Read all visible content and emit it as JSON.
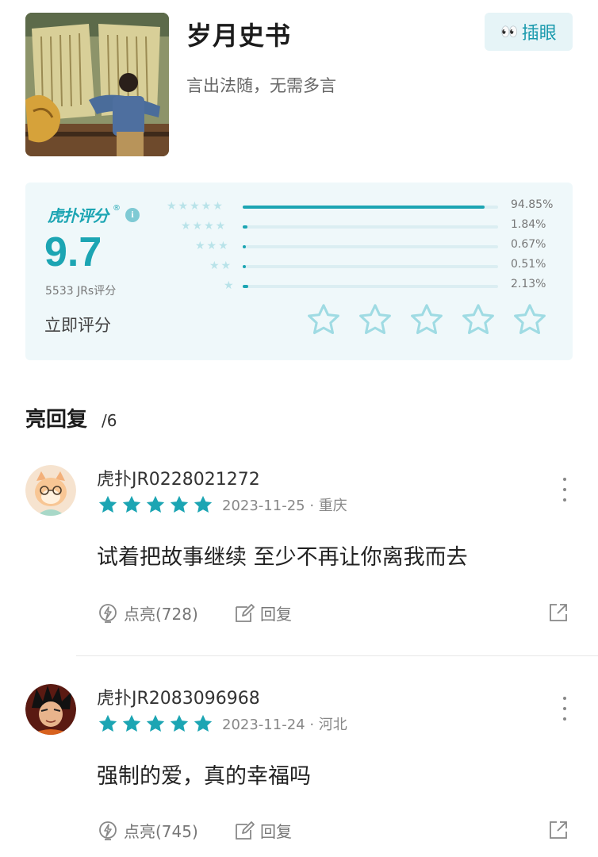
{
  "header": {
    "title": "岁月史书",
    "subtitle": "言出法随，无需多言",
    "tag_label": "插眼",
    "tag_icon": "eyes-icon"
  },
  "rating": {
    "brand": "虎扑评分",
    "score": "9.7",
    "count_text": "5533 JRs评分",
    "rate_now": "立即评分",
    "distribution": [
      {
        "stars": 5,
        "percent": 94.85,
        "label": "94.85%"
      },
      {
        "stars": 4,
        "percent": 1.84,
        "label": "1.84%"
      },
      {
        "stars": 3,
        "percent": 0.67,
        "label": "0.67%"
      },
      {
        "stars": 2,
        "percent": 0.51,
        "label": "0.51%"
      },
      {
        "stars": 1,
        "percent": 2.13,
        "label": "2.13%"
      }
    ]
  },
  "section": {
    "title": "亮回复",
    "count": "/6"
  },
  "comments": [
    {
      "username": "虎扑JR0228021272",
      "stars": 5,
      "date_location": "2023-11-25 · 重庆",
      "content": "试着把故事继续 至少不再让你离我而去",
      "like_label": "点亮(728)",
      "reply_label": "回复"
    },
    {
      "username": "虎扑JR2083096968",
      "stars": 5,
      "date_location": "2023-11-24 · 河北",
      "content": "强制的爱，真的幸福吗",
      "like_label": "点亮(745)",
      "reply_label": "回复"
    }
  ],
  "colors": {
    "accent": "#1ca5b3",
    "card_bg": "#eff8fa",
    "tag_bg": "#e6f4f7"
  }
}
